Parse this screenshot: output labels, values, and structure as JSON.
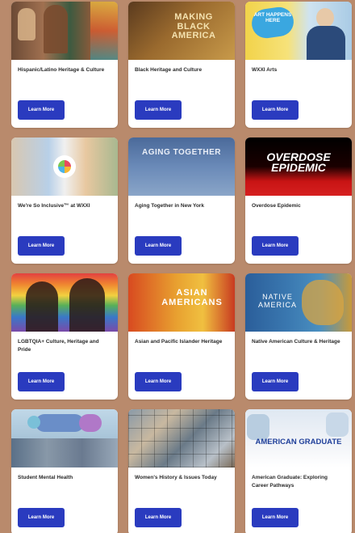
{
  "cards": [
    {
      "title": "Hispanic/Latino Heritage & Culture",
      "button": "Learn More",
      "thumb_text": ""
    },
    {
      "title": "Black Heritage and Culture",
      "button": "Learn More",
      "thumb_text": "MAKING BLACK AMERICA"
    },
    {
      "title": "WXXI Arts",
      "button": "Learn More",
      "thumb_text": "ART HAPPENS HERE"
    },
    {
      "title": "We're So Inclusive™ at WXXI",
      "button": "Learn More",
      "thumb_text": ""
    },
    {
      "title": "Aging Together in New York",
      "button": "Learn More",
      "thumb_text": "AGING TOGETHER"
    },
    {
      "title": "Overdose Epidemic",
      "button": "Learn More",
      "thumb_text": "OVERDOSE EPIDEMIC"
    },
    {
      "title": "LGBTQIA+ Culture, Heritage and Pride",
      "button": "Learn More",
      "thumb_text": ""
    },
    {
      "title": "Asian and Pacific Islander Heritage",
      "button": "Learn More",
      "thumb_text": "ASIAN AMERICANS"
    },
    {
      "title": "Native American Culture & Heritage",
      "button": "Learn More",
      "thumb_text": "NATIVE AMERICA"
    },
    {
      "title": "Student Mental Health",
      "button": "Learn More",
      "thumb_text": ""
    },
    {
      "title": "Women's History & Issues Today",
      "button": "Learn More",
      "thumb_text": ""
    },
    {
      "title": "American Graduate: Exploring Career Pathways",
      "button": "Learn More",
      "thumb_text": "AMERICAN GRADUATE"
    }
  ]
}
